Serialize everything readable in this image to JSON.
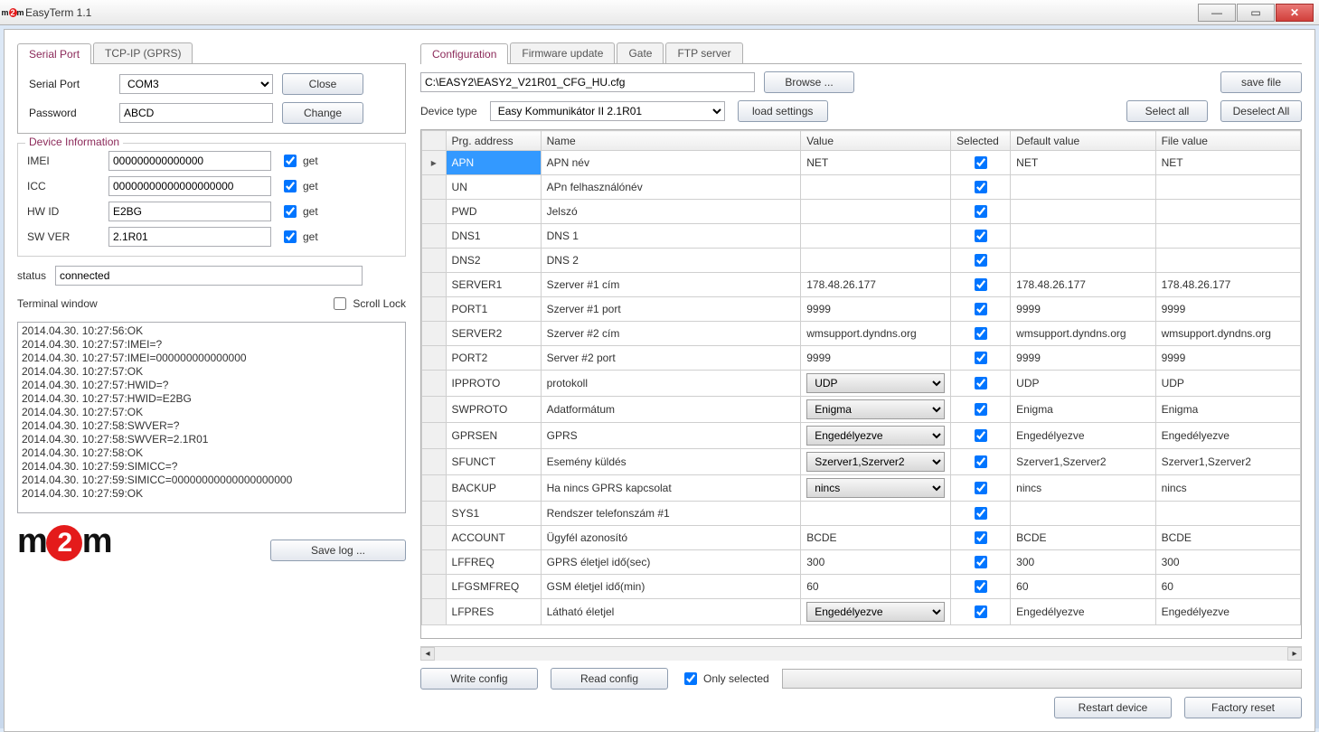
{
  "titlebar": {
    "title": "EasyTerm 1.1"
  },
  "left": {
    "tabs": {
      "serial": "Serial Port",
      "tcp": "TCP-IP (GPRS)"
    },
    "serial": {
      "port_label": "Serial Port",
      "port_value": "COM3",
      "close": "Close",
      "pwd_label": "Password",
      "pwd_value": "ABCD",
      "change": "Change"
    },
    "devinfo": {
      "title": "Device Information",
      "get": "get",
      "rows": [
        {
          "label": "IMEI",
          "value": "000000000000000"
        },
        {
          "label": "ICC",
          "value": "00000000000000000000"
        },
        {
          "label": "HW ID",
          "value": "E2BG"
        },
        {
          "label": "SW VER",
          "value": "2.1R01"
        }
      ]
    },
    "status": {
      "label": "status",
      "value": "connected"
    },
    "terminal": {
      "label": "Terminal window",
      "scroll_lock": "Scroll Lock",
      "lines": [
        "2014.04.30. 10:27:56:OK",
        "2014.04.30. 10:27:57:IMEI=?",
        "2014.04.30. 10:27:57:IMEI=000000000000000",
        "2014.04.30. 10:27:57:OK",
        "2014.04.30. 10:27:57:HWID=?",
        "2014.04.30. 10:27:57:HWID=E2BG",
        "2014.04.30. 10:27:57:OK",
        "2014.04.30. 10:27:58:SWVER=?",
        "2014.04.30. 10:27:58:SWVER=2.1R01",
        "2014.04.30. 10:27:58:OK",
        "2014.04.30. 10:27:59:SIMICC=?",
        "2014.04.30. 10:27:59:SIMICC=00000000000000000000",
        "2014.04.30. 10:27:59:OK"
      ]
    },
    "save_log": "Save log ..."
  },
  "right": {
    "tabs": {
      "config": "Configuration",
      "fw": "Firmware update",
      "gate": "Gate",
      "ftp": "FTP server"
    },
    "file_path": "C:\\EASY2\\EASY2_V21R01_CFG_HU.cfg",
    "browse": "Browse ...",
    "save_file": "save file",
    "device_type_label": "Device type",
    "device_type_value": "Easy Kommunikátor II 2.1R01",
    "load_settings": "load settings",
    "select_all": "Select all",
    "deselect_all": "Deselect All",
    "columns": {
      "prg": "Prg. address",
      "name": "Name",
      "value": "Value",
      "selected": "Selected",
      "default": "Default value",
      "file": "File value"
    },
    "rows": [
      {
        "prg": "APN",
        "name": "APN név",
        "value": "NET",
        "sel": true,
        "default": "NET",
        "file": "NET",
        "dd": false,
        "active": true
      },
      {
        "prg": "UN",
        "name": "APn felhasználónév",
        "value": "",
        "sel": true,
        "default": "",
        "file": "",
        "dd": false
      },
      {
        "prg": "PWD",
        "name": "Jelszó",
        "value": "",
        "sel": true,
        "default": "",
        "file": "",
        "dd": false
      },
      {
        "prg": "DNS1",
        "name": "DNS 1",
        "value": "",
        "sel": true,
        "default": "",
        "file": "",
        "dd": false
      },
      {
        "prg": "DNS2",
        "name": "DNS 2",
        "value": "",
        "sel": true,
        "default": "",
        "file": "",
        "dd": false
      },
      {
        "prg": "SERVER1",
        "name": "Szerver #1 cím",
        "value": "178.48.26.177",
        "sel": true,
        "default": "178.48.26.177",
        "file": "178.48.26.177",
        "dd": false
      },
      {
        "prg": "PORT1",
        "name": "Szerver #1 port",
        "value": "9999",
        "sel": true,
        "default": "9999",
        "file": "9999",
        "dd": false
      },
      {
        "prg": "SERVER2",
        "name": "Szerver #2 cím",
        "value": "wmsupport.dyndns.org",
        "sel": true,
        "default": "wmsupport.dyndns.org",
        "file": "wmsupport.dyndns.org",
        "dd": false
      },
      {
        "prg": "PORT2",
        "name": "Server #2 port",
        "value": "9999",
        "sel": true,
        "default": "9999",
        "file": "9999",
        "dd": false
      },
      {
        "prg": "IPPROTO",
        "name": "protokoll",
        "value": "UDP",
        "sel": true,
        "default": "UDP",
        "file": "UDP",
        "dd": true
      },
      {
        "prg": "SWPROTO",
        "name": "Adatformátum",
        "value": "Enigma",
        "sel": true,
        "default": "Enigma",
        "file": "Enigma",
        "dd": true
      },
      {
        "prg": "GPRSEN",
        "name": "GPRS",
        "value": "Engedélyezve",
        "sel": true,
        "default": "Engedélyezve",
        "file": "Engedélyezve",
        "dd": true
      },
      {
        "prg": "SFUNCT",
        "name": "Esemény küldés",
        "value": "Szerver1,Szerver2",
        "sel": true,
        "default": "Szerver1,Szerver2",
        "file": "Szerver1,Szerver2",
        "dd": true
      },
      {
        "prg": "BACKUP",
        "name": "Ha nincs GPRS kapcsolat",
        "value": "nincs",
        "sel": true,
        "default": "nincs",
        "file": "nincs",
        "dd": true
      },
      {
        "prg": "SYS1",
        "name": "Rendszer telefonszám #1",
        "value": "",
        "sel": true,
        "default": "",
        "file": "",
        "dd": false
      },
      {
        "prg": "ACCOUNT",
        "name": "Ügyfél azonosító",
        "value": "BCDE",
        "sel": true,
        "default": "BCDE",
        "file": "BCDE",
        "dd": false
      },
      {
        "prg": "LFFREQ",
        "name": "GPRS életjel idő(sec)",
        "value": "300",
        "sel": true,
        "default": "300",
        "file": "300",
        "dd": false
      },
      {
        "prg": "LFGSMFREQ",
        "name": "GSM életjel idő(min)",
        "value": "60",
        "sel": true,
        "default": "60",
        "file": "60",
        "dd": false
      },
      {
        "prg": "LFPRES",
        "name": "Látható életjel",
        "value": "Engedélyezve",
        "sel": true,
        "default": "Engedélyezve",
        "file": "Engedélyezve",
        "dd": true
      }
    ],
    "write_config": "Write config",
    "read_config": "Read config",
    "only_selected": "Only selected",
    "restart": "Restart device",
    "factory_reset": "Factory reset"
  }
}
